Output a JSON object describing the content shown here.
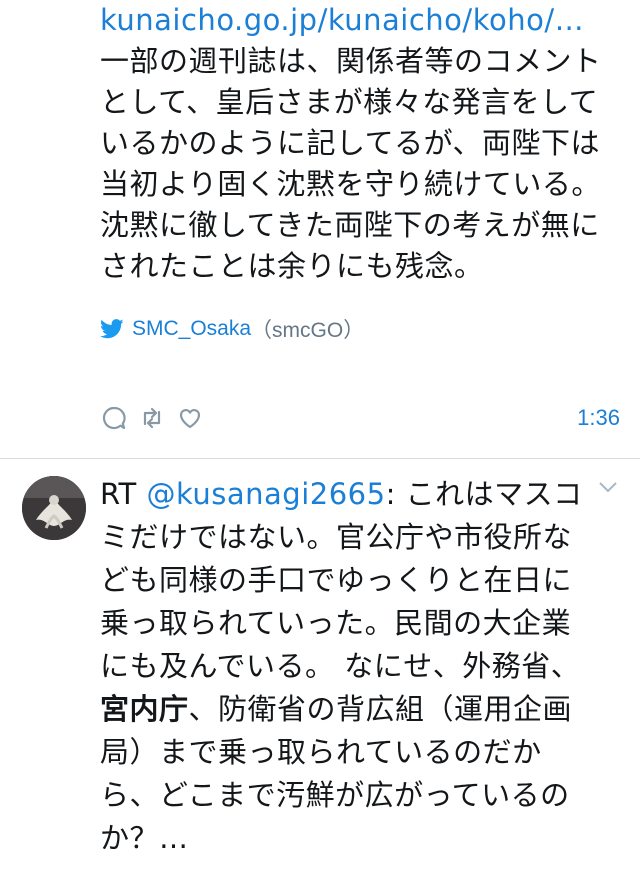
{
  "tweet1": {
    "link_text": "kunaicho.go.jp/kunaicho/koho/…",
    "text": " 一部の週刊誌は、関係者等のコメントとして、皇后さまが様々な発言をしているかのように記してるが、両陛下は当初より固く沈黙を守り続けている。沈黙に徹してきた両陛下の考えが無にされたことは余りにも残念。",
    "via_name": "SMC_Osaka",
    "via_handle": "（smcGO）",
    "time": "1:36"
  },
  "tweet2": {
    "rt_prefix": "RT ",
    "mention": "@kusanagi2665",
    "text_a": ": これはマスコミだけではない。官公庁や市役所なども同様の手口でゆっくりと在日に乗っ取られていった。民間の大企業にも及んでいる。 なにせ、外務省、",
    "bold_text": "宮内庁",
    "text_b": "、防衛省の背広組（運用企画局）まで乗っ取られているのだから、どこまで汚鮮が広がっているのか？…"
  },
  "colors": {
    "link": "#1b7fd6",
    "muted": "#657786",
    "divider": "#d8dde2"
  },
  "icons": [
    "twitter-bird-icon",
    "reply-icon",
    "retweet-icon",
    "like-icon",
    "chevron-down-icon"
  ]
}
